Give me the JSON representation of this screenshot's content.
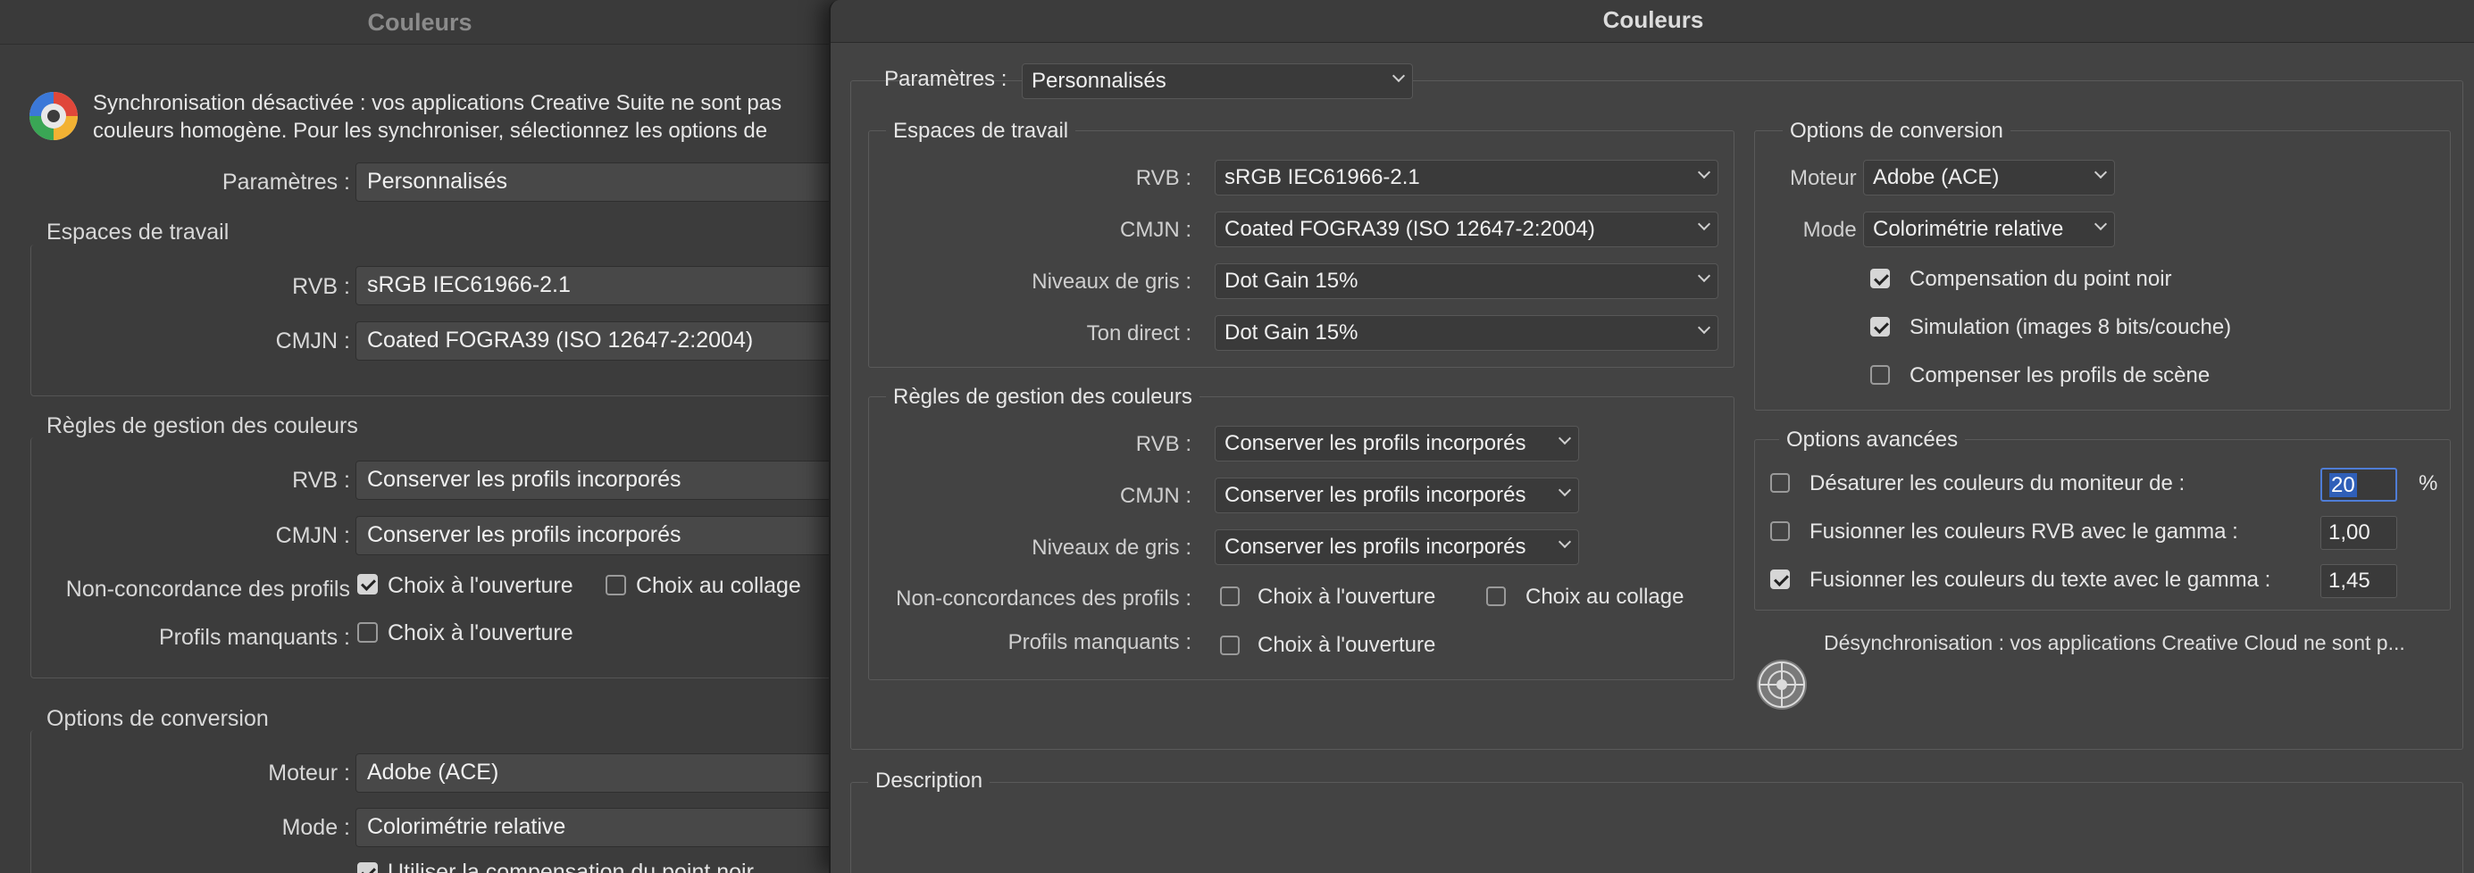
{
  "back_window": {
    "title": "Couleurs",
    "sync_message_line1": "Synchronisation désactivée : vos applications Creative Suite ne sont pas",
    "sync_message_line2": "couleurs homogène. Pour les synchroniser, sélectionnez les options de",
    "settings_label": "Paramètres :",
    "settings_value": "Personnalisés",
    "working_spaces": {
      "title": "Espaces de travail",
      "rgb_label": "RVB :",
      "rgb_value": "sRGB IEC61966-2.1",
      "cmyk_label": "CMJN :",
      "cmyk_value": "Coated FOGRA39 (ISO 12647-2:2004)"
    },
    "policies": {
      "title": "Règles de gestion des couleurs",
      "rgb_label": "RVB :",
      "rgb_value": "Conserver les profils incorporés",
      "cmyk_label": "CMJN :",
      "cmyk_value": "Conserver les profils incorporés",
      "mismatch_label": "Non-concordance des profils",
      "mismatch_open": "Choix à l'ouverture",
      "mismatch_paste": "Choix au collage",
      "missing_label": "Profils manquants :",
      "missing_open": "Choix à l'ouverture"
    },
    "conversion": {
      "title": "Options de conversion",
      "engine_label": "Moteur :",
      "engine_value": "Adobe (ACE)",
      "intent_label": "Mode :",
      "intent_value": "Colorimétrie relative",
      "bpc_partial": "Utiliser la compensation du point noir"
    }
  },
  "front_window": {
    "title": "Couleurs",
    "settings_label": "Paramètres :",
    "settings_value": "Personnalisés",
    "working_spaces": {
      "title": "Espaces de travail",
      "rgb_label": "RVB :",
      "rgb_value": "sRGB IEC61966-2.1",
      "cmyk_label": "CMJN :",
      "cmyk_value": "Coated FOGRA39 (ISO 12647-2:2004)",
      "gray_label": "Niveaux de gris :",
      "gray_value": "Dot Gain 15%",
      "spot_label": "Ton direct :",
      "spot_value": "Dot Gain 15%"
    },
    "policies": {
      "title": "Règles de gestion des couleurs",
      "rgb_label": "RVB :",
      "rgb_value": "Conserver les profils incorporés",
      "cmyk_label": "CMJN :",
      "cmyk_value": "Conserver les profils incorporés",
      "gray_label": "Niveaux de gris :",
      "gray_value": "Conserver les profils incorporés",
      "mismatch_label": "Non-concordances des profils :",
      "mismatch_open": "Choix à l'ouverture",
      "mismatch_paste": "Choix au collage",
      "missing_label": "Profils manquants :",
      "missing_open": "Choix à l'ouverture"
    },
    "conversion": {
      "title": "Options de conversion",
      "engine_label": "Moteur :",
      "engine_value": "Adobe (ACE)",
      "intent_label": "Mode :",
      "intent_value": "Colorimétrie relative",
      "bpc": "Compensation du point noir",
      "dither": "Simulation (images 8 bits/couche)",
      "scene": "Compenser les profils de scène"
    },
    "advanced": {
      "title": "Options avancées",
      "desaturate_label": "Désaturer les couleurs du moniteur de :",
      "desaturate_value": "20",
      "desaturate_unit": "%",
      "blend_rgb_label": "Fusionner les couleurs RVB avec le gamma :",
      "blend_rgb_value": "1,00",
      "blend_text_label": "Fusionner les couleurs du texte avec le gamma :",
      "blend_text_value": "1,45"
    },
    "desync_message": "Désynchronisation : vos applications Creative Cloud ne sont p...",
    "description_title": "Description"
  }
}
